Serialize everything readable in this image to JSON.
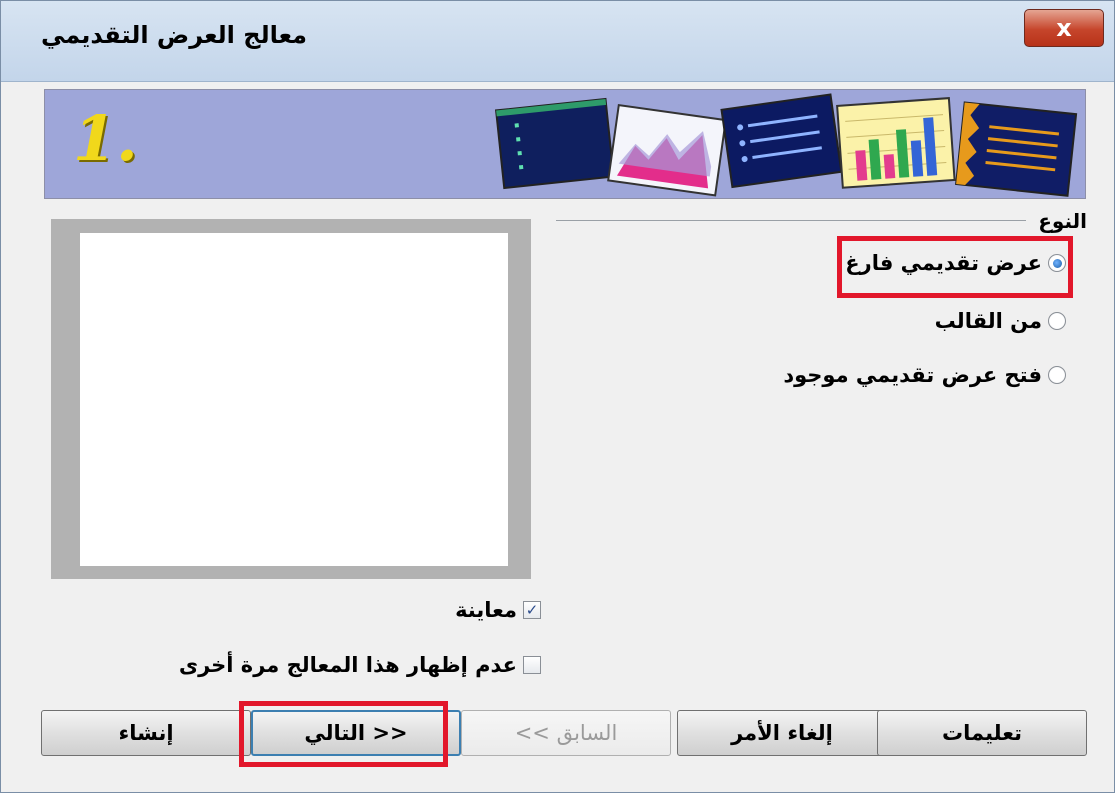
{
  "window": {
    "title": "معالج العرض التقديمي",
    "close_label": "x"
  },
  "banner": {
    "step_number": "1."
  },
  "type_group": {
    "label": "النوع",
    "options": [
      {
        "label": "عرض تقديمي فارغ",
        "checked": true
      },
      {
        "label": "من القالب",
        "checked": false
      },
      {
        "label": "فتح عرض تقديمي موجود",
        "checked": false
      }
    ]
  },
  "options": {
    "preview_label": "معاينة",
    "preview_checked": true,
    "dont_show_label": "عدم إظهار هذا المعالج مرة أخرى",
    "dont_show_checked": false
  },
  "buttons": {
    "create": "إنشاء",
    "next": "التالي >>",
    "back": "<< السابق",
    "cancel": "إلغاء الأمر",
    "help": "تعليمات"
  },
  "colors": {
    "banner_bg": "#9ea6d9",
    "highlight": "#e2172b",
    "close_button": "#c6452b"
  },
  "icons": {
    "close": "close-icon",
    "radio_checked": "radio-checked-icon",
    "checkbox_checked": "checkmark-icon"
  }
}
